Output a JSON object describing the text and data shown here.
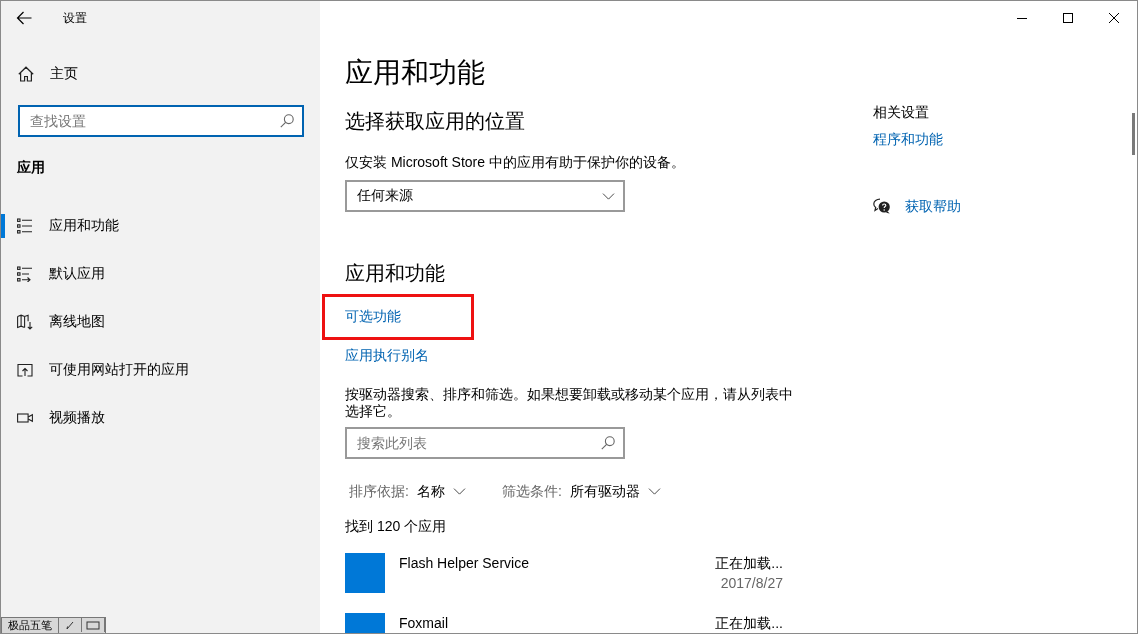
{
  "window": {
    "title": "设置"
  },
  "sidebar": {
    "home": "主页",
    "search": {
      "placeholder": "查找设置"
    },
    "section": "应用",
    "items": [
      {
        "label": "应用和功能",
        "selected": true
      },
      {
        "label": "默认应用",
        "selected": false
      },
      {
        "label": "离线地图",
        "selected": false
      },
      {
        "label": "可使用网站打开的应用",
        "selected": false
      },
      {
        "label": "视频播放",
        "selected": false
      }
    ]
  },
  "main": {
    "title": "应用和功能",
    "install_source": {
      "heading": "选择获取应用的位置",
      "description": "仅安装 Microsoft Store 中的应用有助于保护你的设备。",
      "dropdown": {
        "value": "任何来源"
      }
    },
    "apps_features": {
      "heading": "应用和功能",
      "links": [
        {
          "label": "可选功能",
          "highlighted": true
        },
        {
          "label": "应用执行别名",
          "highlighted": false
        }
      ],
      "description": "按驱动器搜索、排序和筛选。如果想要卸载或移动某个应用，请从列表中选择它。",
      "search": {
        "placeholder": "搜索此列表"
      },
      "sort": {
        "label": "排序依据:",
        "value": "名称"
      },
      "filter": {
        "label": "筛选条件:",
        "value": "所有驱动器"
      },
      "count": "找到 120 个应用",
      "apps": [
        {
          "name": "Flash Helper Service",
          "size": "正在加载...",
          "date": "2017/8/27"
        },
        {
          "name": "Foxmail",
          "size": "正在加载..."
        }
      ]
    }
  },
  "related": {
    "heading": "相关设置",
    "links": [
      {
        "label": "程序和功能"
      }
    ],
    "help": "获取帮助"
  },
  "ime_toolbar": {
    "name": "极品五笔"
  }
}
